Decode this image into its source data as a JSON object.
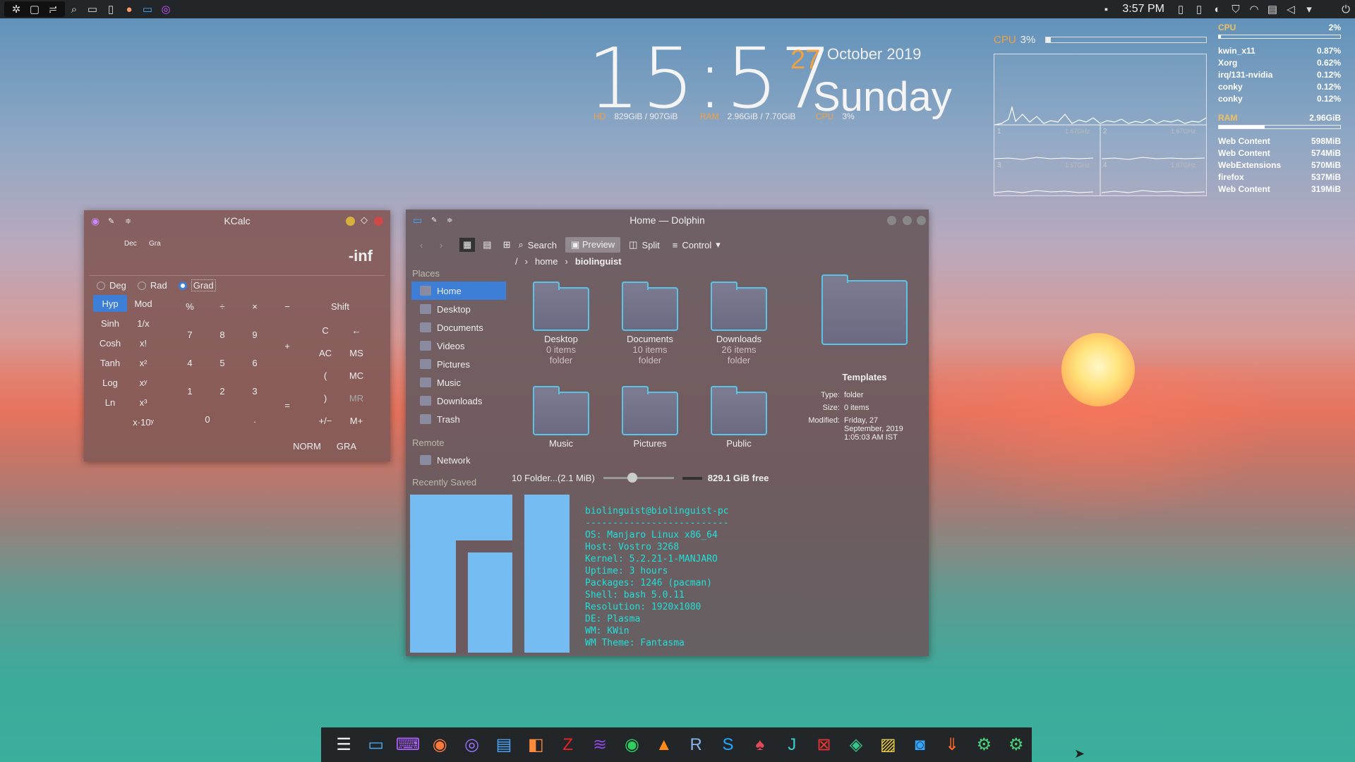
{
  "topbar": {
    "time": "3:57 PM"
  },
  "clock": {
    "time": "15:57",
    "day": "27",
    "month": "October 2019",
    "weekday": "Sunday",
    "hd_label": "HD",
    "hd_value": "829GiB / 907GiB",
    "ram_label": "RAM",
    "ram_value": "2.96GiB / 7.70GiB",
    "cpu_label": "CPU",
    "cpu_value": "3%"
  },
  "cpu_conky": {
    "label": "CPU",
    "value": "3%",
    "cores": [
      {
        "id": "1",
        "freq": "1.67GHz"
      },
      {
        "id": "2",
        "freq": "1.67GHz"
      },
      {
        "id": "3",
        "freq": "1.67GHz"
      },
      {
        "id": "4",
        "freq": "1.67GHz"
      }
    ]
  },
  "right_conky": {
    "cpu_label": "CPU",
    "cpu_value": "2%",
    "cpu_procs": [
      {
        "name": "kwin_x11",
        "val": "0.87%"
      },
      {
        "name": "Xorg",
        "val": "0.62%"
      },
      {
        "name": "irq/131-nvidia",
        "val": "0.12%"
      },
      {
        "name": "conky",
        "val": "0.12%"
      },
      {
        "name": "conky",
        "val": "0.12%"
      }
    ],
    "ram_label": "RAM",
    "ram_value": "2.96GiB",
    "ram_procs": [
      {
        "name": "Web Content",
        "val": "598MiB"
      },
      {
        "name": "Web Content",
        "val": "574MiB"
      },
      {
        "name": "WebExtensions",
        "val": "570MiB"
      },
      {
        "name": "firefox",
        "val": "537MiB"
      },
      {
        "name": "Web Content",
        "val": "319MiB"
      }
    ]
  },
  "kcalc": {
    "title": "KCalc",
    "dec": "Dec",
    "gra": "Gra",
    "display": "-inf",
    "deg": "Deg",
    "rad": "Rad",
    "grad": "Grad",
    "left": [
      "Hyp",
      "Mod",
      "Sinh",
      "1/x",
      "Cosh",
      "x!",
      "Tanh",
      "x²",
      "Log",
      "xʸ",
      "Ln",
      "x³",
      "",
      "x·10ʸ"
    ],
    "ops": [
      "%",
      "÷",
      "×",
      "−"
    ],
    "nums": [
      "7",
      "8",
      "9",
      "4",
      "5",
      "6",
      "1",
      "2",
      "3",
      "0",
      "."
    ],
    "plus": "+",
    "eq": "=",
    "right": [
      "Shift",
      "C",
      "←",
      "AC",
      "MS",
      "(",
      "MC",
      ")",
      "MR",
      "+/−",
      "M+"
    ],
    "norm": "NORM",
    "gra2": "GRA"
  },
  "dolphin": {
    "title": "Home — Dolphin",
    "search": "Search",
    "preview": "Preview",
    "split": "Split",
    "control": "Control",
    "crumb_root": "/",
    "crumb_home": "home",
    "crumb_user": "biolinguist",
    "places": "Places",
    "remote": "Remote",
    "recent": "Recently Saved",
    "side": [
      "Home",
      "Desktop",
      "Documents",
      "Videos",
      "Pictures",
      "Music",
      "Downloads",
      "Trash"
    ],
    "network": "Network",
    "items": [
      {
        "name": "Desktop",
        "sub1": "0 items",
        "sub2": "folder"
      },
      {
        "name": "Documents",
        "sub1": "10 items",
        "sub2": "folder"
      },
      {
        "name": "Downloads",
        "sub1": "26 items",
        "sub2": "folder"
      },
      {
        "name": "Music",
        "sub1": "",
        "sub2": ""
      },
      {
        "name": "Pictures",
        "sub1": "",
        "sub2": ""
      },
      {
        "name": "Public",
        "sub1": "",
        "sub2": ""
      }
    ],
    "info": {
      "name": "Templates",
      "type_l": "Type:",
      "type": "folder",
      "size_l": "Size:",
      "size": "0 items",
      "mod_l": "Modified:",
      "mod": "Friday, 27 September, 2019 1:05:03 AM IST"
    },
    "status": "10 Folder...(2.1 MiB)",
    "free": "829.1 GiB free"
  },
  "terminal": {
    "lines": [
      "biolinguist@biolinguist-pc",
      "--------------------------",
      "OS: Manjaro Linux x86_64",
      "Host: Vostro 3268",
      "Kernel: 5.2.21-1-MANJARO",
      "Uptime: 3 hours",
      "Packages: 1246 (pacman)",
      "Shell: bash 5.0.11",
      "Resolution: 1920x1080",
      "DE: Plasma",
      "WM: KWin",
      "WM Theme: Fantasma"
    ]
  },
  "colors": {
    "accent": "#3d7fd6",
    "orange": "#f0a040",
    "cyan": "#1fe0d8"
  }
}
